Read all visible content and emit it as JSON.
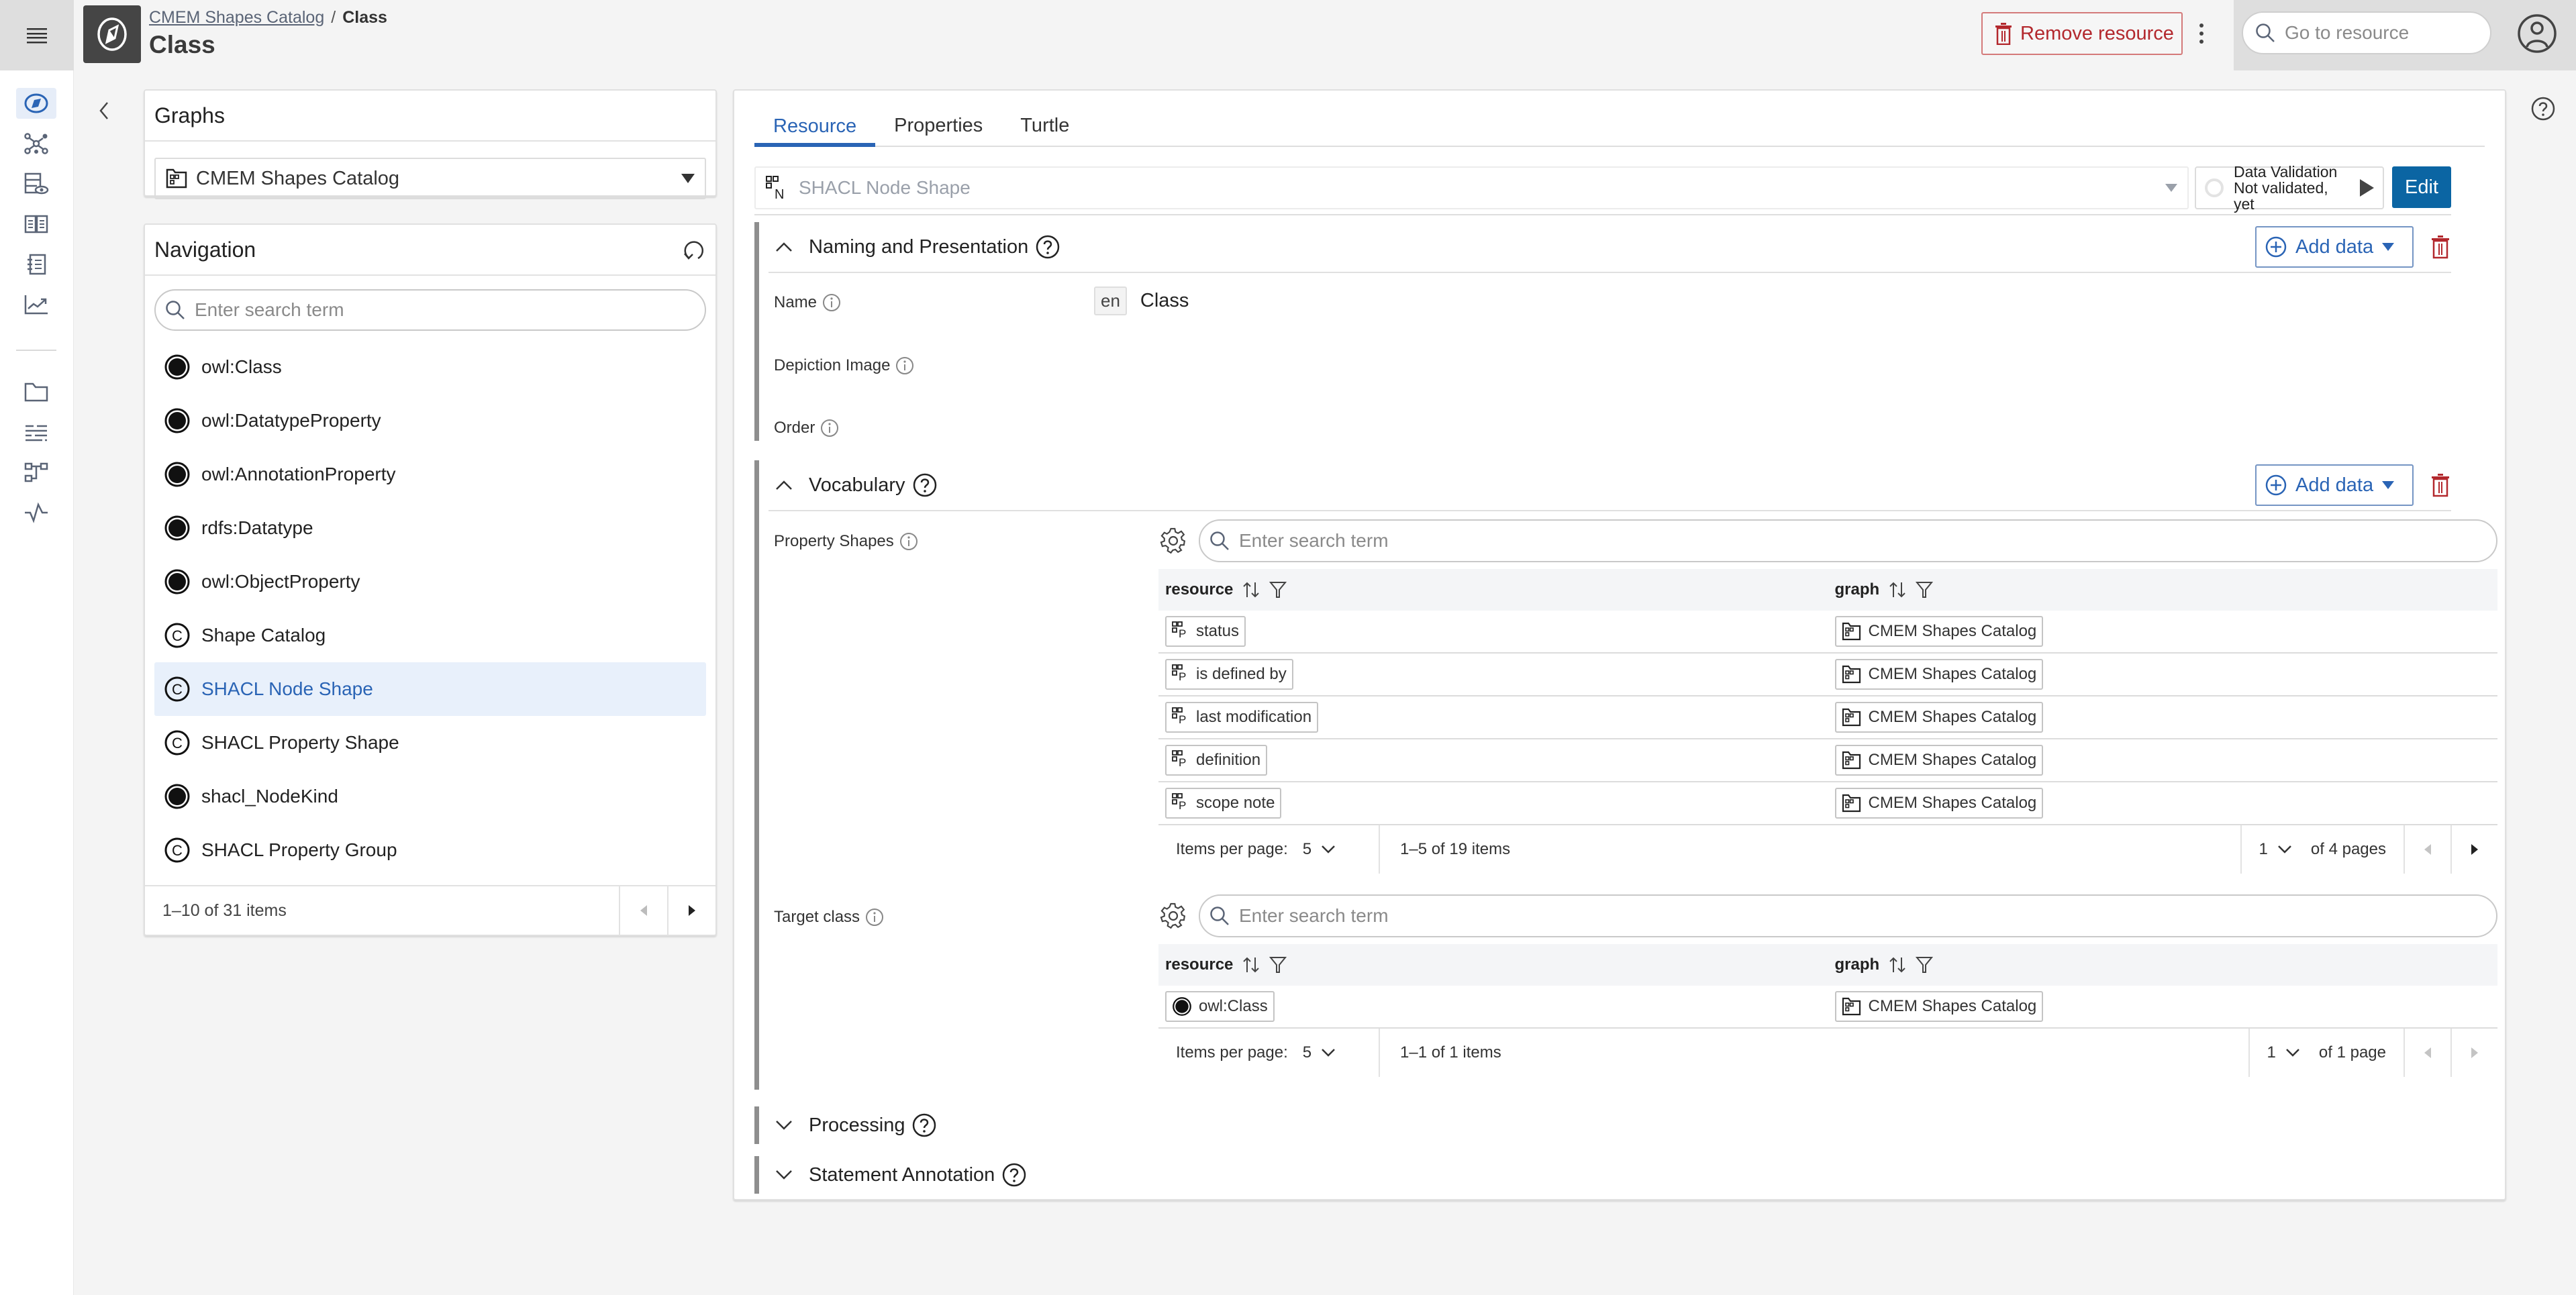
{
  "header": {
    "breadcrumb_parent": "CMEM Shapes Catalog",
    "breadcrumb_separator": "/",
    "breadcrumb_current": "Class",
    "title": "Class",
    "remove_button": "Remove resource",
    "goto_placeholder": "Go to resource"
  },
  "rail": {
    "items": [
      {
        "icon": "explore-icon",
        "active": true
      },
      {
        "icon": "knowledge-graph-icon",
        "active": false
      },
      {
        "icon": "dataset-view-icon",
        "active": false
      },
      {
        "icon": "vocabulary-book-icon",
        "active": false
      },
      {
        "icon": "notebook-list-icon",
        "active": false
      },
      {
        "icon": "analytics-chart-icon",
        "active": false
      },
      {
        "icon": "folder-icon",
        "active": false
      },
      {
        "icon": "mapping-list-icon",
        "active": false
      },
      {
        "icon": "workflow-icon",
        "active": false
      },
      {
        "icon": "activity-icon",
        "active": false
      }
    ]
  },
  "graphs": {
    "title": "Graphs",
    "selected": "CMEM Shapes Catalog"
  },
  "navigation": {
    "title": "Navigation",
    "search_placeholder": "Enter search term",
    "items": [
      {
        "label": "owl:Class",
        "icon": "instance",
        "selected": false
      },
      {
        "label": "owl:DatatypeProperty",
        "icon": "instance",
        "selected": false
      },
      {
        "label": "owl:AnnotationProperty",
        "icon": "instance",
        "selected": false
      },
      {
        "label": "rdfs:Datatype",
        "icon": "instance",
        "selected": false
      },
      {
        "label": "owl:ObjectProperty",
        "icon": "instance",
        "selected": false
      },
      {
        "label": "Shape Catalog",
        "icon": "class",
        "selected": false
      },
      {
        "label": "SHACL Node Shape",
        "icon": "class",
        "selected": true
      },
      {
        "label": "SHACL Property Shape",
        "icon": "class",
        "selected": false
      },
      {
        "label": "shacl_NodeKind",
        "icon": "instance",
        "selected": false
      },
      {
        "label": "SHACL Property Group",
        "icon": "class",
        "selected": false
      }
    ],
    "pagination": "1–10 of 31 items"
  },
  "main": {
    "tabs": [
      {
        "label": "Resource",
        "active": true
      },
      {
        "label": "Properties",
        "active": false
      },
      {
        "label": "Turtle",
        "active": false
      }
    ],
    "shape_select": "SHACL Node Shape",
    "validation": {
      "title": "Data Validation",
      "status": "Not validated, yet"
    },
    "edit_button": "Edit",
    "add_data_label": "Add data",
    "groups": {
      "naming": {
        "title": "Naming and Presentation",
        "fields": {
          "name": {
            "label": "Name",
            "lang": "en",
            "value": "Class"
          },
          "depiction": {
            "label": "Depiction Image"
          },
          "order": {
            "label": "Order"
          }
        }
      },
      "vocabulary": {
        "title": "Vocabulary",
        "property_shapes": {
          "label": "Property Shapes",
          "search_placeholder": "Enter search term",
          "columns": [
            "resource",
            "graph"
          ],
          "rows": [
            {
              "resource": "status",
              "graph": "CMEM Shapes Catalog"
            },
            {
              "resource": "is defined by",
              "graph": "CMEM Shapes Catalog"
            },
            {
              "resource": "last modification",
              "graph": "CMEM Shapes Catalog"
            },
            {
              "resource": "definition",
              "graph": "CMEM Shapes Catalog"
            },
            {
              "resource": "scope note",
              "graph": "CMEM Shapes Catalog"
            }
          ],
          "items_per_page_label": "Items per page:",
          "items_per_page": "5",
          "range": "1–5 of 19 items",
          "page": "1",
          "pages": "of 4 pages"
        },
        "target_class": {
          "label": "Target class",
          "search_placeholder": "Enter search term",
          "columns": [
            "resource",
            "graph"
          ],
          "rows": [
            {
              "resource": "owl:Class",
              "graph": "CMEM Shapes Catalog"
            }
          ],
          "items_per_page_label": "Items per page:",
          "items_per_page": "5",
          "range": "1–1 of 1 items",
          "page": "1",
          "pages": "of 1 page"
        }
      },
      "processing": {
        "title": "Processing"
      },
      "statement_annotation": {
        "title": "Statement Annotation"
      }
    }
  },
  "colors": {
    "accent": "#2a64b5",
    "primary_button": "#0b65a3",
    "danger": "#b3282d",
    "selected_bg": "#e8f0fb"
  }
}
